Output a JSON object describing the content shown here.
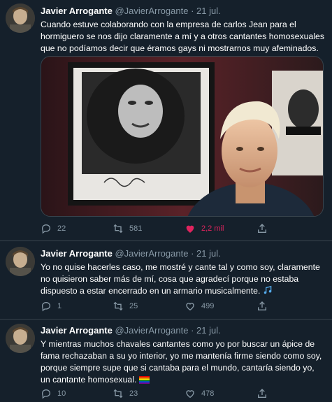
{
  "tweets": [
    {
      "name": "Javier Arrogante",
      "handle": "@JavierArrogante",
      "separator": "·",
      "date": "21 jul.",
      "text": "Cuando estuve colaborando con la empresa de carlos Jean para el hormiguero se nos dijo claramente a mí y a otros cantantes homosexuales que no podíamos decir que éramos gays ni mostrarnos muy afeminados.",
      "replies": "22",
      "retweets": "581",
      "likes": "2,2 mil",
      "liked": true,
      "has_media": true
    },
    {
      "name": "Javier Arrogante",
      "handle": "@JavierArrogante",
      "separator": "·",
      "date": "21 jul.",
      "text": "Yo no quise hacerles caso, me mostré y cante tal y como soy, claramente no quisieron saber más de mí, cosa que agradecí porque no estaba dispuesto a estar encerrado en un armario musicalmente.",
      "emoji": "music-notes",
      "replies": "1",
      "retweets": "25",
      "likes": "499",
      "liked": false
    },
    {
      "name": "Javier Arrogante",
      "handle": "@JavierArrogante",
      "separator": "·",
      "date": "21 jul.",
      "text": "Y mientras muchos chavales cantantes como yo por buscar un ápice de fama rechazaban a su yo interior, yo me mantenía firme siendo como soy, porque siempre supe que si cantaba para el mundo, cantaría siendo yo, un cantante homosexual.",
      "emoji": "rainbow-flag",
      "replies": "10",
      "retweets": "23",
      "likes": "478",
      "liked": false
    }
  ],
  "colors": {
    "background": "#15202b",
    "secondary_text": "#8899a6",
    "like_active": "#e0245e",
    "divider": "#38444d"
  }
}
